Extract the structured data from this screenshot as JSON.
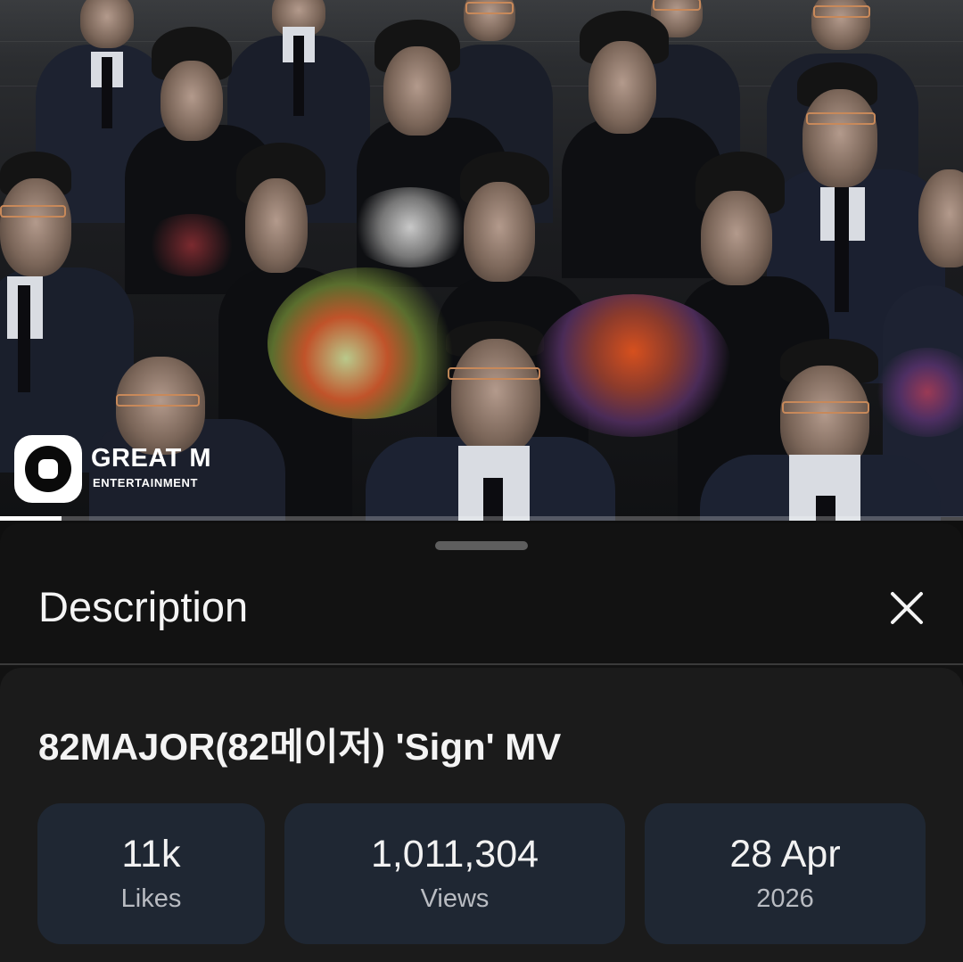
{
  "video": {
    "channel_logo": {
      "brand": "GREAT M",
      "subtitle": "ENTERTAINMENT",
      "icon": "great-m-logo-icon"
    },
    "progress": 0.064
  },
  "description_sheet": {
    "title": "Description",
    "close_icon": "close-icon",
    "video_title": "82MAJOR(82메이저) 'Sign' MV",
    "stats": [
      {
        "value": "11k",
        "label": "Likes"
      },
      {
        "value": "1,011,304",
        "label": "Views"
      },
      {
        "value": "28 Apr",
        "label": "2026"
      }
    ]
  },
  "colors": {
    "background": "#0f0f0f",
    "card": "#1b1b1b",
    "stat_chip": "#1f2733",
    "progress": "#ffffff"
  }
}
